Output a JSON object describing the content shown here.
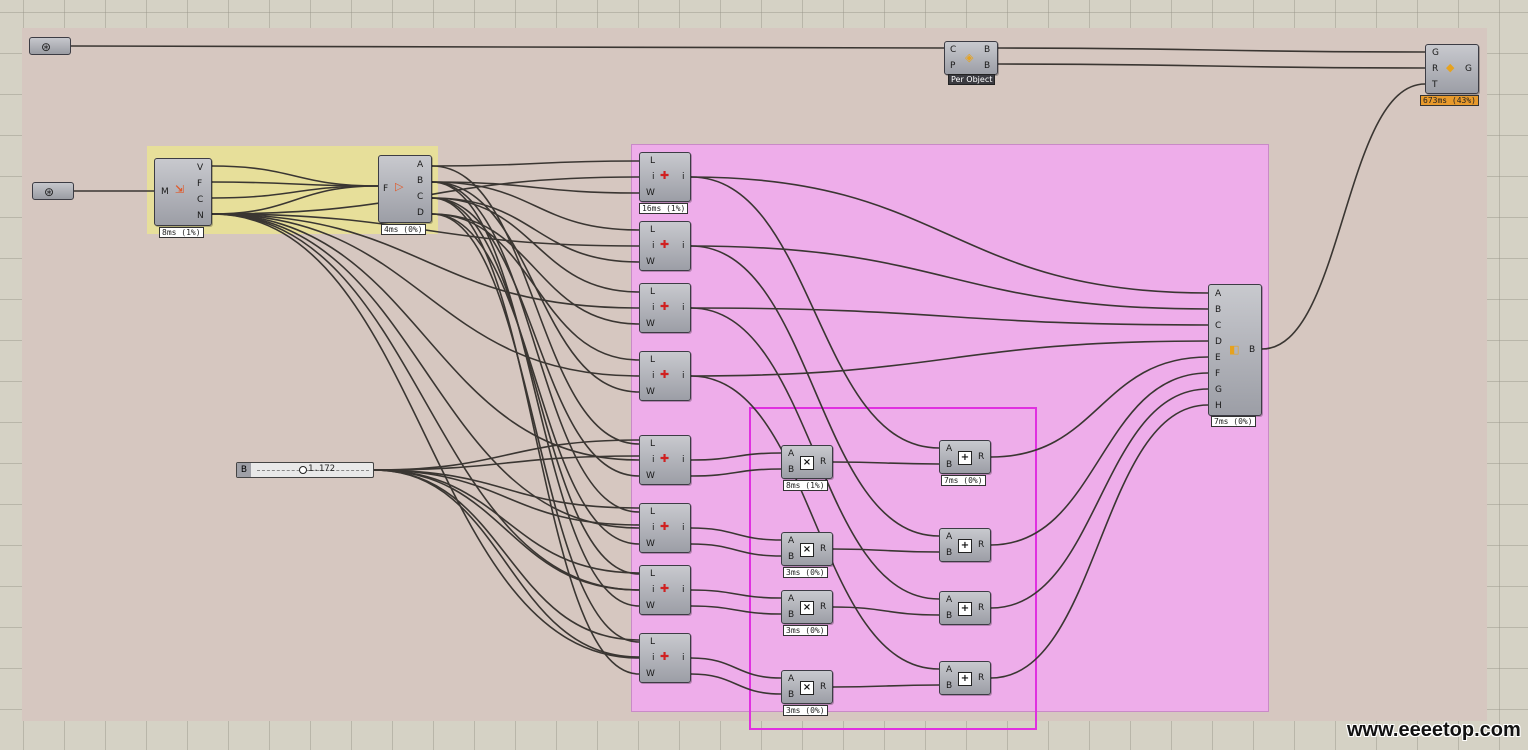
{
  "colors": {
    "canvas": "#d5d2c5",
    "group_main": "#d6c7c0",
    "group_yellow": "#e7df9a",
    "group_pink": "#eeadea",
    "outline_magenta": "#e030e0",
    "timing_warn": "#e89a2c"
  },
  "watermark": "www.eeeetop.com",
  "params": {
    "top_hex_icon": "mesh-param-icon",
    "left_hex_icon": "brep-param-icon"
  },
  "comp_deconstruct": {
    "in": "M",
    "outs": [
      "V",
      "F",
      "C",
      "N"
    ],
    "timing": "8ms (1%)",
    "icon": "deconstruct-mesh-icon"
  },
  "comp_list": {
    "in": "F",
    "outs": [
      "A",
      "B",
      "C",
      "D"
    ],
    "timing": "4ms (0%)",
    "icon": "list-item-icon"
  },
  "comp_color": {
    "ins": [
      "C",
      "P"
    ],
    "outs": [
      "B",
      "B"
    ],
    "label": "Per Object",
    "icon": "custom-preview-icon"
  },
  "comp_geo": {
    "ins": [
      "G",
      "R",
      "T"
    ],
    "out": "G",
    "timing": "673ms (43%)",
    "icon": "geometry-icon"
  },
  "comp_merge": {
    "ins": [
      "A",
      "B",
      "C",
      "D",
      "E",
      "F",
      "G",
      "H"
    ],
    "out": "B",
    "timing": "7ms (0%)",
    "icon": "merge-icon"
  },
  "lerp_in": [
    "L",
    "i",
    "W"
  ],
  "lerp_out": "i",
  "lerps": [
    {
      "timing": "16ms (1%)"
    },
    {
      "timing": ""
    },
    {
      "timing": ""
    },
    {
      "timing": ""
    },
    {
      "timing": ""
    },
    {
      "timing": ""
    },
    {
      "timing": ""
    },
    {
      "timing": ""
    }
  ],
  "mults": [
    {
      "timing": "8ms (1%)"
    },
    {
      "timing": "3ms (0%)"
    },
    {
      "timing": "3ms (0%)"
    },
    {
      "timing": "3ms (0%)"
    }
  ],
  "adds": [
    {
      "timing": "7ms (0%)"
    },
    {
      "timing": ""
    },
    {
      "timing": ""
    },
    {
      "timing": ""
    }
  ],
  "op_ins": [
    "A",
    "B"
  ],
  "op_out": "R",
  "mult_symbol": "×",
  "add_symbol": "+",
  "slider": {
    "label": "B",
    "value": "1.172"
  }
}
